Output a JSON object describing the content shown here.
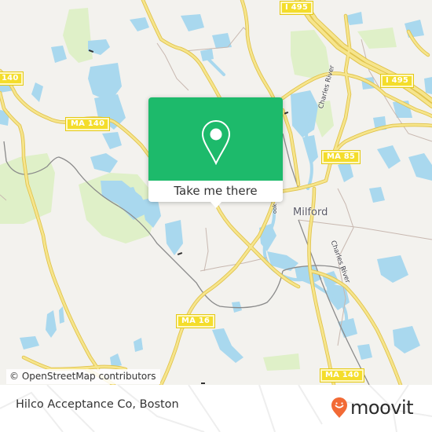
{
  "map": {
    "place_labels": [
      {
        "id": "milford",
        "text": "Milford"
      }
    ],
    "river_labels": [
      {
        "id": "charles-river-north",
        "text": "Charles River"
      },
      {
        "id": "charles-river-south",
        "text": "Charles River"
      },
      {
        "id": "brook",
        "text": "Brook"
      }
    ],
    "route_shields": [
      {
        "id": "i495-top",
        "text": "I 495"
      },
      {
        "id": "i495-right",
        "text": "I 495"
      },
      {
        "id": "ma140-left",
        "text": "140"
      },
      {
        "id": "ma140-mid",
        "text": "MA 140"
      },
      {
        "id": "ma85",
        "text": "MA 85"
      },
      {
        "id": "ma16",
        "text": "MA 16"
      },
      {
        "id": "ma140-bottom",
        "text": "MA 140"
      }
    ],
    "colors": {
      "land": "#f3f2ee",
      "water": "#a9d8ee",
      "park": "#dff0c8",
      "road": "#f4dd6a",
      "road_casing": "#e0c24a",
      "rail": "#8a8a8a",
      "boundary": "#c8b8b0"
    }
  },
  "popup": {
    "button_label": "Take me there",
    "icon": "map-pin-icon",
    "color": "#1dba6b"
  },
  "attribution": {
    "text": "© OpenStreetMap contributors"
  },
  "footer": {
    "place_name": "Hilco Acceptance Co, Boston",
    "brand": {
      "name": "moovit",
      "logo_icon": "moovit-smiley-pin-icon",
      "color": "#f26a35"
    }
  }
}
